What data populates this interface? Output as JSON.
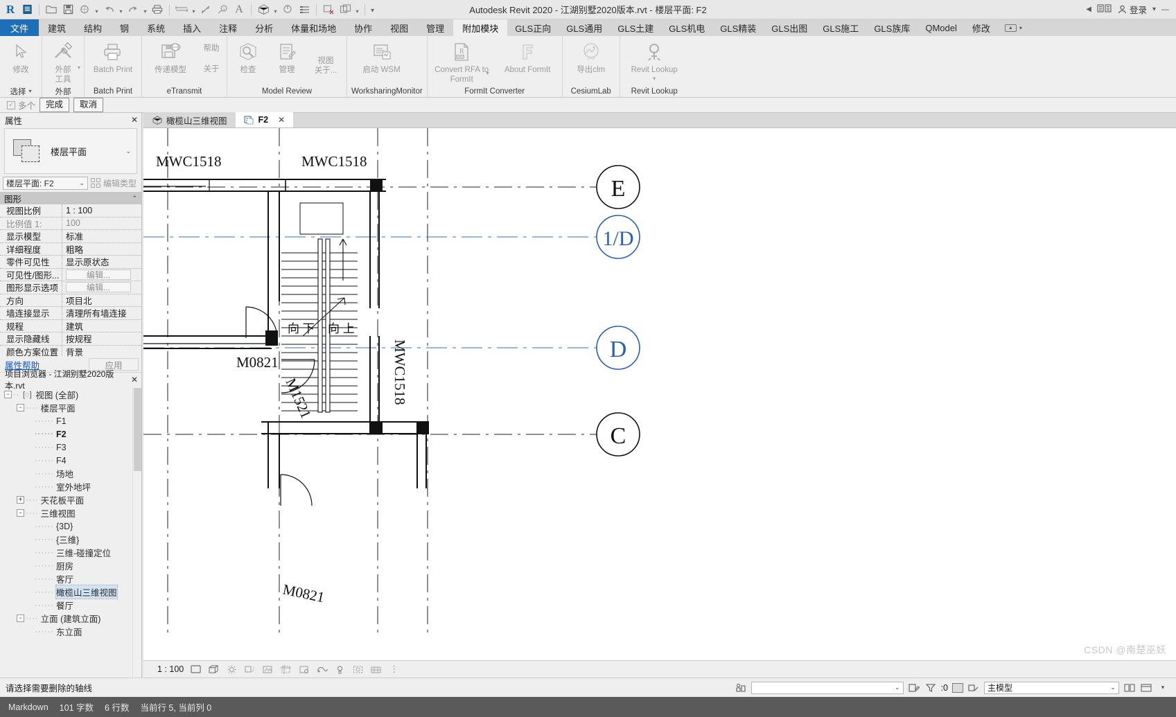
{
  "window": {
    "title": "Autodesk Revit 2020 - 江湖别墅2020版本.rvt - 楼层平面: F2",
    "sign_in": "登录"
  },
  "quick_access": {
    "icons": [
      "revit-logo",
      "new-sheet",
      "open",
      "save",
      "save-as",
      "undo",
      "redo",
      "print",
      "measure",
      "aligned-dimension",
      "tag",
      "text",
      "3d-view",
      "section",
      "thin-lines",
      "close-hidden",
      "window-tile",
      "customize-qat"
    ]
  },
  "ribbon_tabs": [
    {
      "label": "文件",
      "state": "file"
    },
    {
      "label": "建筑",
      "state": "normal"
    },
    {
      "label": "结构",
      "state": "normal"
    },
    {
      "label": "钢",
      "state": "normal"
    },
    {
      "label": "系统",
      "state": "normal"
    },
    {
      "label": "插入",
      "state": "normal"
    },
    {
      "label": "注释",
      "state": "normal"
    },
    {
      "label": "分析",
      "state": "normal"
    },
    {
      "label": "体量和场地",
      "state": "normal"
    },
    {
      "label": "协作",
      "state": "normal"
    },
    {
      "label": "视图",
      "state": "normal"
    },
    {
      "label": "管理",
      "state": "normal"
    },
    {
      "label": "附加模块",
      "state": "active"
    },
    {
      "label": "GLS正向",
      "state": "normal"
    },
    {
      "label": "GLS通用",
      "state": "normal"
    },
    {
      "label": "GLS土建",
      "state": "normal"
    },
    {
      "label": "GLS机电",
      "state": "normal"
    },
    {
      "label": "GLS精装",
      "state": "normal"
    },
    {
      "label": "GLS出图",
      "state": "normal"
    },
    {
      "label": "GLS施工",
      "state": "normal"
    },
    {
      "label": "GLS族库",
      "state": "normal"
    },
    {
      "label": "QModel",
      "state": "normal"
    },
    {
      "label": "修改",
      "state": "normal"
    }
  ],
  "ribbon_panels": [
    {
      "title": "选择",
      "title_caret": "▾",
      "buttons": [
        {
          "label": "修改",
          "icon": "cursor-arrow",
          "enabled": false,
          "width": "normal",
          "caret": ""
        }
      ]
    },
    {
      "title": "外部",
      "title_caret": "",
      "buttons": [
        {
          "label": "外部\n工具",
          "icon": "tools-wrench-hammer",
          "enabled": false,
          "width": "normal",
          "caret": "side"
        }
      ]
    },
    {
      "title": "Batch Print",
      "title_caret": "",
      "buttons": [
        {
          "label": "Batch Print",
          "icon": "printer",
          "enabled": false,
          "width": "wide",
          "caret": ""
        }
      ]
    },
    {
      "title": "eTransmit",
      "title_caret": "",
      "buttons": [
        {
          "label": "传递模型",
          "icon": "floppy-globe",
          "enabled": false,
          "width": "wide",
          "caret": ""
        },
        {
          "label": "帮助",
          "icon": "",
          "enabled": false,
          "width": "small",
          "caret": ""
        },
        {
          "label": "关于",
          "icon": "",
          "enabled": false,
          "width": "small",
          "caret": ""
        }
      ]
    },
    {
      "title": "Model Review",
      "title_caret": "",
      "buttons": [
        {
          "label": "检查",
          "icon": "magnifier-box",
          "enabled": false,
          "width": "normal",
          "caret": ""
        },
        {
          "label": "管理",
          "icon": "list-pencil",
          "enabled": false,
          "width": "normal",
          "caret": ""
        },
        {
          "label": "视图\n关于...",
          "icon": "",
          "enabled": false,
          "width": "normal",
          "caret": ""
        }
      ]
    },
    {
      "title": "WorksharingMonitor",
      "title_caret": "",
      "buttons": [
        {
          "label": "启动 WSM",
          "icon": "monitor-chart",
          "enabled": false,
          "width": "xwide",
          "caret": ""
        }
      ]
    },
    {
      "title": "FormIt Converter",
      "title_caret": "",
      "buttons": [
        {
          "label": "Convert RFA to FormIt",
          "icon": "rfa-doc",
          "enabled": false,
          "width": "xwide",
          "caret": "side"
        },
        {
          "label": "About FormIt",
          "icon": "formit-f",
          "enabled": false,
          "width": "xwide",
          "caret": ""
        }
      ]
    },
    {
      "title": "CesiumLab",
      "title_caret": "",
      "buttons": [
        {
          "label": "导出clm",
          "icon": "cesium-lab",
          "enabled": false,
          "width": "wide",
          "caret": ""
        }
      ]
    },
    {
      "title": "Revit Lookup",
      "title_caret": "",
      "buttons": [
        {
          "label": "Revit Lookup",
          "icon": "lookup-key",
          "enabled": false,
          "width": "xwide",
          "caret": "drop"
        }
      ]
    }
  ],
  "options_bar": {
    "checkbox_label": "多个",
    "checkbox_checked": true,
    "finish_label": "完成",
    "cancel_label": "取消"
  },
  "properties": {
    "title": "属性",
    "close": "✕",
    "type_icon_label": "楼层平面",
    "type_selector_value": "楼层平面: F2",
    "edit_type_label": "编辑类型",
    "group_header": "图形",
    "rows": [
      {
        "key": "视图比例",
        "value": "1 : 100",
        "key_dim": false,
        "value_dim": false,
        "type": "text"
      },
      {
        "key": "比例值 1:",
        "value": "100",
        "key_dim": true,
        "value_dim": true,
        "type": "text"
      },
      {
        "key": "显示模型",
        "value": "标准",
        "key_dim": false,
        "value_dim": false,
        "type": "text"
      },
      {
        "key": "详细程度",
        "value": "粗略",
        "key_dim": false,
        "value_dim": false,
        "type": "text"
      },
      {
        "key": "零件可见性",
        "value": "显示原状态",
        "key_dim": false,
        "value_dim": false,
        "type": "text"
      },
      {
        "key": "可见性/图形...",
        "value": "编辑...",
        "key_dim": false,
        "value_dim": true,
        "type": "button"
      },
      {
        "key": "图形显示选项",
        "value": "编辑...",
        "key_dim": false,
        "value_dim": true,
        "type": "button"
      },
      {
        "key": "方向",
        "value": "项目北",
        "key_dim": false,
        "value_dim": false,
        "type": "text"
      },
      {
        "key": "墙连接显示",
        "value": "清理所有墙连接",
        "key_dim": false,
        "value_dim": false,
        "type": "text"
      },
      {
        "key": "规程",
        "value": "建筑",
        "key_dim": false,
        "value_dim": false,
        "type": "text"
      },
      {
        "key": "显示隐藏线",
        "value": "按规程",
        "key_dim": false,
        "value_dim": false,
        "type": "text"
      },
      {
        "key": "颜色方案位置",
        "value": "背景",
        "key_dim": false,
        "value_dim": false,
        "type": "text"
      }
    ],
    "help_link": "属性帮助",
    "apply_label": "应用"
  },
  "browser": {
    "title": "项目浏览器 - 江湖别墅2020版本.rvt",
    "close": "✕",
    "nodes": [
      {
        "label": "视图 (全部)",
        "depth": 0,
        "toggle": "-",
        "icon": "view-bracket",
        "bold": false,
        "selected": false
      },
      {
        "label": "楼层平面",
        "depth": 1,
        "toggle": "-",
        "icon": "",
        "bold": false,
        "selected": false
      },
      {
        "label": "F1",
        "depth": 2,
        "toggle": "",
        "icon": "",
        "bold": false,
        "selected": false
      },
      {
        "label": "F2",
        "depth": 2,
        "toggle": "",
        "icon": "",
        "bold": true,
        "selected": false
      },
      {
        "label": "F3",
        "depth": 2,
        "toggle": "",
        "icon": "",
        "bold": false,
        "selected": false
      },
      {
        "label": "F4",
        "depth": 2,
        "toggle": "",
        "icon": "",
        "bold": false,
        "selected": false
      },
      {
        "label": "场地",
        "depth": 2,
        "toggle": "",
        "icon": "",
        "bold": false,
        "selected": false
      },
      {
        "label": "室外地坪",
        "depth": 2,
        "toggle": "",
        "icon": "",
        "bold": false,
        "selected": false
      },
      {
        "label": "天花板平面",
        "depth": 1,
        "toggle": "+",
        "icon": "",
        "bold": false,
        "selected": false
      },
      {
        "label": "三维视图",
        "depth": 1,
        "toggle": "-",
        "icon": "",
        "bold": false,
        "selected": false
      },
      {
        "label": "{3D}",
        "depth": 2,
        "toggle": "",
        "icon": "",
        "bold": false,
        "selected": false
      },
      {
        "label": "{三维}",
        "depth": 2,
        "toggle": "",
        "icon": "",
        "bold": false,
        "selected": false
      },
      {
        "label": "三维-碰撞定位",
        "depth": 2,
        "toggle": "",
        "icon": "",
        "bold": false,
        "selected": false
      },
      {
        "label": "厨房",
        "depth": 2,
        "toggle": "",
        "icon": "",
        "bold": false,
        "selected": false
      },
      {
        "label": "客厅",
        "depth": 2,
        "toggle": "",
        "icon": "",
        "bold": false,
        "selected": false
      },
      {
        "label": "橄榄山三维视图",
        "depth": 2,
        "toggle": "",
        "icon": "",
        "bold": false,
        "selected": true
      },
      {
        "label": "餐厅",
        "depth": 2,
        "toggle": "",
        "icon": "",
        "bold": false,
        "selected": false
      },
      {
        "label": "立面 (建筑立面)",
        "depth": 1,
        "toggle": "-",
        "icon": "",
        "bold": false,
        "selected": false
      },
      {
        "label": "东立面",
        "depth": 2,
        "toggle": "",
        "icon": "",
        "bold": false,
        "selected": false
      }
    ]
  },
  "view_tabs": [
    {
      "label": "橄榄山三维视图",
      "icon": "house-3d-icon",
      "active": false,
      "close": "✕"
    },
    {
      "label": "F2",
      "icon": "plan-view-icon",
      "active": true,
      "close": "✕"
    }
  ],
  "drawing": {
    "door_window_tags": [
      "MWC1518",
      "MWC1518",
      "MWC1518",
      "M0821",
      "M1521",
      "M0821"
    ],
    "stair_labels": [
      "向 下",
      "向 上"
    ],
    "grid_bubbles": [
      {
        "label": "E",
        "color": "#111111"
      },
      {
        "label": "1/D",
        "color": "#1b4fa0"
      },
      {
        "label": "D",
        "color": "#1b4fa0"
      },
      {
        "label": "C",
        "color": "#111111"
      }
    ]
  },
  "view_control_bar": {
    "scale": "1 : 100",
    "icons": [
      "detail-level-coarse",
      "visual-style-wireframe",
      "sun-path",
      "shadows-off",
      "render-dialog",
      "crop-view",
      "crop-region-hide",
      "unlock-3d-view",
      "temp-hide-isolate",
      "reveal-hidden",
      "analytical-model",
      "more"
    ]
  },
  "status_bar": {
    "message": "请选择需要删除的轴线",
    "worksets_icon": "worksets-icon",
    "search_placeholder": "",
    "design_options_value": "主模型",
    "filter_count": ":0",
    "filter_icon": "filter-icon"
  },
  "editor_bar": {
    "mode": "Markdown",
    "chars": "101 字数",
    "lines": "6 行数",
    "cursor": "当前行 5, 当前列 0"
  },
  "watermark": "CSDN @南楚巫妖",
  "colors": {
    "accent_blue": "#1d6fb8",
    "grid_blue": "#1b4fa0",
    "ribbon_bg": "#efefef",
    "panel_bg": "#efefef",
    "canvas_bg": "#ffffff"
  }
}
